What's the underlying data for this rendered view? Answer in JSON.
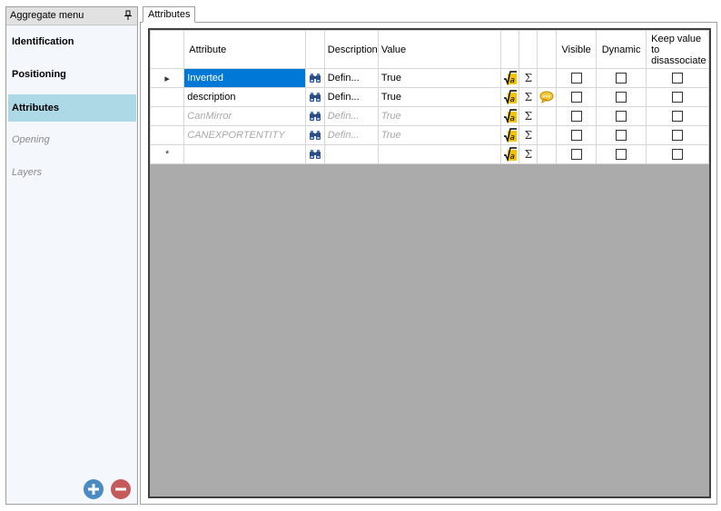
{
  "left_panel": {
    "title": "Aggregate menu",
    "items": [
      {
        "label": "Identification",
        "state": "normal"
      },
      {
        "label": "Positioning",
        "state": "normal"
      },
      {
        "label": "Attributes",
        "state": "selected"
      },
      {
        "label": "Opening",
        "state": "disabled"
      },
      {
        "label": "Layers",
        "state": "disabled"
      }
    ]
  },
  "tab": {
    "label": "Attributes"
  },
  "table": {
    "headers": {
      "attribute": "Attribute",
      "description": "Description",
      "value": "Value",
      "visible": "Visible",
      "dynamic": "Dynamic",
      "keep_value": "Keep value to disassociate"
    },
    "rows": [
      {
        "attribute": "Inverted",
        "description": "Defin...",
        "value": "True",
        "visible": false,
        "dynamic": false,
        "keep": false,
        "inherited": false,
        "comment": false
      },
      {
        "attribute": "description",
        "description": "Defin...",
        "value": "True",
        "visible": false,
        "dynamic": false,
        "keep": false,
        "inherited": false,
        "comment": true
      },
      {
        "attribute": "CanMirror",
        "description": "Defin...",
        "value": "True",
        "visible": false,
        "dynamic": false,
        "keep": false,
        "inherited": true,
        "comment": false
      },
      {
        "attribute": "CANEXPORTENTITY",
        "description": "Defin...",
        "value": "True",
        "visible": false,
        "dynamic": false,
        "keep": false,
        "inherited": true,
        "comment": false
      },
      {
        "attribute": "",
        "description": "",
        "value": "",
        "visible": false,
        "dynamic": false,
        "keep": false,
        "inherited": false,
        "comment": false
      }
    ],
    "row_markers": {
      "current": "▸",
      "new": "*"
    },
    "sigma_symbol": "Σ"
  },
  "colors": {
    "selected_menu": "#add8e6",
    "selected_cell": "#0078d7",
    "grid_background": "#ababab",
    "add_button": "#4a8bc4",
    "remove_button": "#c55a5a"
  }
}
